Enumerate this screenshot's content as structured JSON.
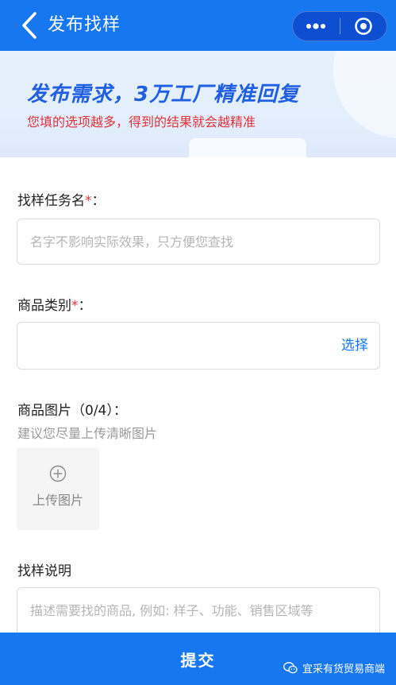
{
  "navbar": {
    "title": "发布找样",
    "back_icon": "chevron-left-icon",
    "more_icon": "more-dots-icon",
    "close_icon": "target-circle-icon",
    "color": "#1677f0"
  },
  "banner": {
    "headline": "发布需求，3万工厂精准回复",
    "subtitle": "您填的选项越多，得到的结果就会越精准"
  },
  "form": {
    "task_name": {
      "label": "找样任务名",
      "required_mark": "*",
      "suffix": "：",
      "placeholder": "名字不影响实际效果，只方便您查找"
    },
    "category": {
      "label": "商品类别",
      "required_mark": "*",
      "suffix": "：",
      "value": "",
      "select_text": "选择"
    },
    "images": {
      "label": "商品图片（0/4）：",
      "hint": "建议您尽量上传清晰图片",
      "upload_text": "上传图片",
      "upload_icon": "plus-circle-icon"
    },
    "description": {
      "label": "找样说明",
      "placeholder": "描述需要找的商品, 例如: 样子、功能、销售区域等"
    }
  },
  "footer": {
    "submit_label": "提交",
    "watermark": "宜采有货贸易商端",
    "watermark_icon": "wechat-icon"
  }
}
